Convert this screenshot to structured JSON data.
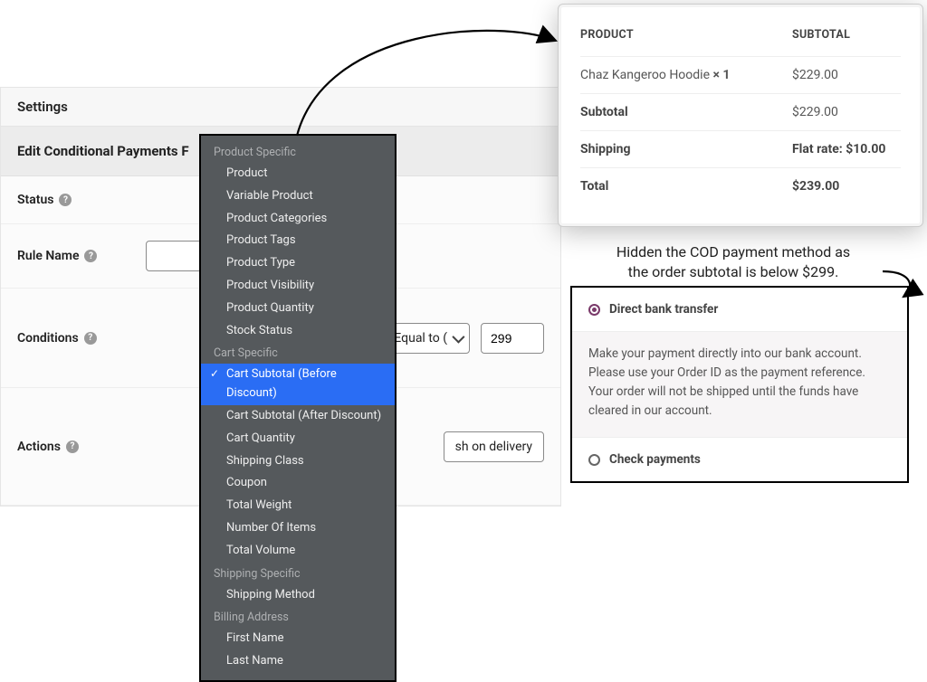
{
  "settingsTitle": "Settings",
  "editTitle": "Edit Conditional Payments F",
  "rows": {
    "status": "Status",
    "ruleName": "Rule Name",
    "conditions": "Conditions",
    "actions": "Actions"
  },
  "conditionOp": "r Equal to (",
  "conditionValue": "299",
  "actionPill": "sh on delivery",
  "dropdown": {
    "g1": "Product Specific",
    "g1items": [
      "Product",
      "Variable Product",
      "Product Categories",
      "Product Tags",
      "Product Type",
      "Product Visibility",
      "Product Quantity",
      "Stock Status"
    ],
    "g2": "Cart Specific",
    "g2items": [
      "Cart Subtotal (Before Discount)",
      "Cart Subtotal (After Discount)",
      "Cart Quantity",
      "Shipping Class",
      "Coupon",
      "Total Weight",
      "Number Of Items",
      "Total Volume"
    ],
    "g2selectedIndex": 0,
    "g3": "Shipping Specific",
    "g3items": [
      "Shipping Method"
    ],
    "g4": "Billing Address",
    "g4items": [
      "First Name",
      "Last Name"
    ]
  },
  "checkout": {
    "headProduct": "PRODUCT",
    "headSubtotal": "SUBTOTAL",
    "itemName": "Chaz Kangeroo Hoodie ",
    "itemQty": "× 1",
    "itemPrice": "$229.00",
    "subtotalLabel": "Subtotal",
    "subtotalValue": "$229.00",
    "shippingLabel": "Shipping",
    "shippingValue": "Flat rate: $10.00",
    "totalLabel": "Total",
    "totalValue": "$239.00"
  },
  "annotationLine1": "Hidden the COD payment method as",
  "annotationLine2": "the order subtotal is below $299.",
  "payments": {
    "opt1": "Direct bank transfer",
    "opt1desc": "Make your payment directly into our bank account. Please use your Order ID as the payment reference. Your order will not be shipped until the funds have cleared in our account.",
    "opt2": "Check payments"
  }
}
